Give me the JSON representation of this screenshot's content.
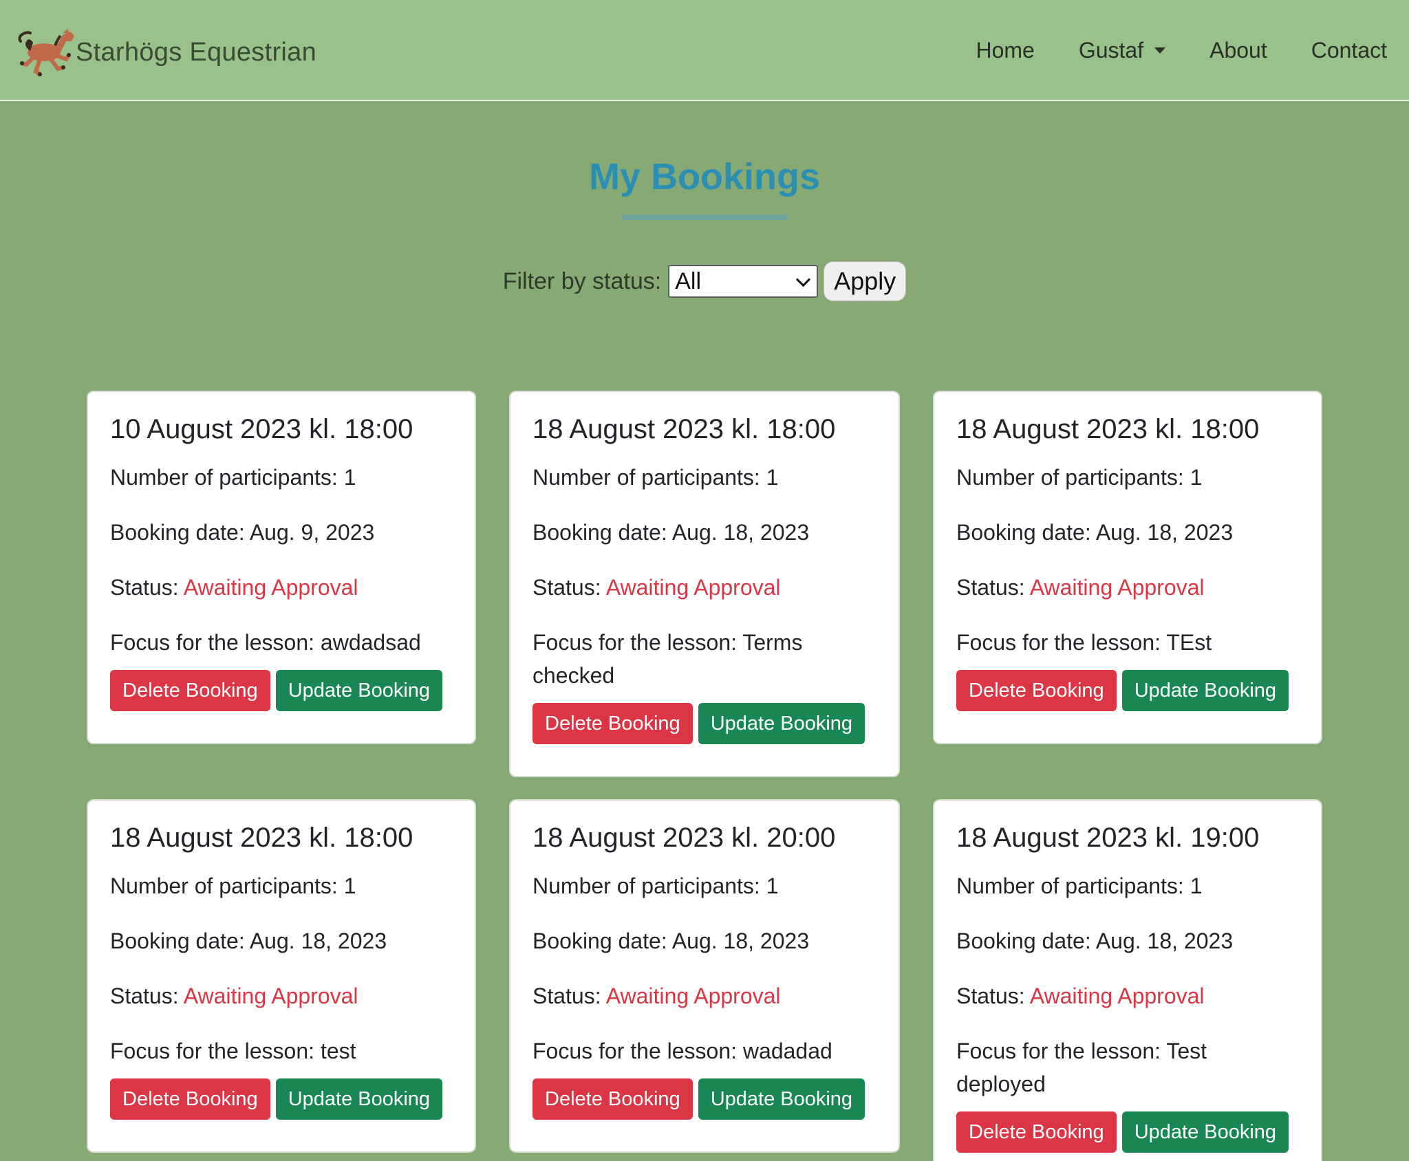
{
  "nav": {
    "brand": "Starhögs Equestrian",
    "logo_icon": "horse-icon",
    "links": {
      "home": "Home",
      "user": "Gustaf",
      "about": "About",
      "contact": "Contact"
    }
  },
  "page": {
    "title": "My Bookings"
  },
  "filter": {
    "label": "Filter by status:",
    "selected": "All",
    "apply_label": "Apply"
  },
  "colors": {
    "status_awaiting": "#dc3545",
    "delete_button": "#dc3545",
    "update_button": "#198754",
    "title": "#2b8fb4"
  },
  "bookings": [
    {
      "title": "10 August 2023 kl. 18:00",
      "participants": "Number of participants: 1",
      "booking_date": "Booking date: Aug. 9, 2023",
      "status_label": "Status: ",
      "status_value": "Awaiting Approval",
      "focus": "Focus for the lesson: awdadsad",
      "delete_label": "Delete Booking",
      "update_label": "Update Booking"
    },
    {
      "title": "18 August 2023 kl. 18:00",
      "participants": "Number of participants: 1",
      "booking_date": "Booking date: Aug. 18, 2023",
      "status_label": "Status: ",
      "status_value": "Awaiting Approval",
      "focus": "Focus for the lesson: Terms checked",
      "delete_label": "Delete Booking",
      "update_label": "Update Booking"
    },
    {
      "title": "18 August 2023 kl. 18:00",
      "participants": "Number of participants: 1",
      "booking_date": "Booking date: Aug. 18, 2023",
      "status_label": "Status: ",
      "status_value": "Awaiting Approval",
      "focus": "Focus for the lesson: TEst",
      "delete_label": "Delete Booking",
      "update_label": "Update Booking"
    },
    {
      "title": "18 August 2023 kl. 18:00",
      "participants": "Number of participants: 1",
      "booking_date": "Booking date: Aug. 18, 2023",
      "status_label": "Status: ",
      "status_value": "Awaiting Approval",
      "focus": "Focus for the lesson: test",
      "delete_label": "Delete Booking",
      "update_label": "Update Booking"
    },
    {
      "title": "18 August 2023 kl. 20:00",
      "participants": "Number of participants: 1",
      "booking_date": "Booking date: Aug. 18, 2023",
      "status_label": "Status: ",
      "status_value": "Awaiting Approval",
      "focus": "Focus for the lesson: wadadad",
      "delete_label": "Delete Booking",
      "update_label": "Update Booking"
    },
    {
      "title": "18 August 2023 kl. 19:00",
      "participants": "Number of participants: 1",
      "booking_date": "Booking date: Aug. 18, 2023",
      "status_label": "Status: ",
      "status_value": "Awaiting Approval",
      "focus": "Focus for the lesson: Test deployed",
      "delete_label": "Delete Booking",
      "update_label": "Update Booking"
    }
  ]
}
